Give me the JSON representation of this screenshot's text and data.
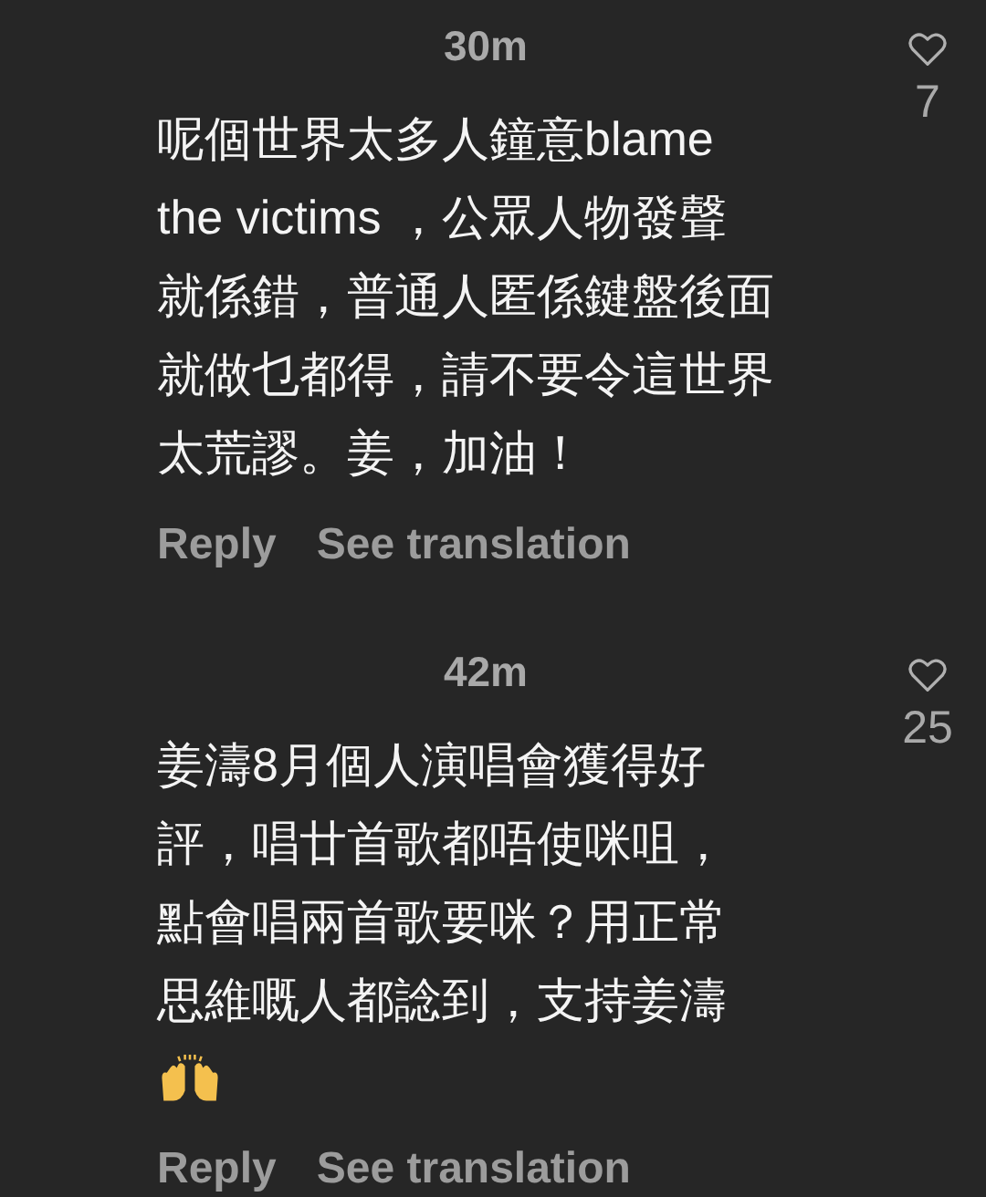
{
  "comments": [
    {
      "time": "30m",
      "lines": [
        "呢個世界太多人鐘意blame",
        "the victims ，公眾人物發聲",
        "就係錯，普通人匿係鍵盤後面",
        "就做乜都得，請不要令這世界",
        "太荒謬。姜，加油！"
      ],
      "emoji_line": false,
      "liked": false,
      "likes": "7",
      "actions": [
        "Reply",
        "See translation"
      ]
    },
    {
      "time": "42m",
      "lines": [
        "姜濤8月個人演唱會獲得好",
        "評，唱廿首歌都唔使咪咀，",
        "點會唱兩首歌要咪？用正常",
        "思維嘅人都諗到，支持姜濤"
      ],
      "emoji_line": true,
      "liked": false,
      "likes": "25",
      "actions": [
        "Reply",
        "See translation"
      ]
    }
  ]
}
